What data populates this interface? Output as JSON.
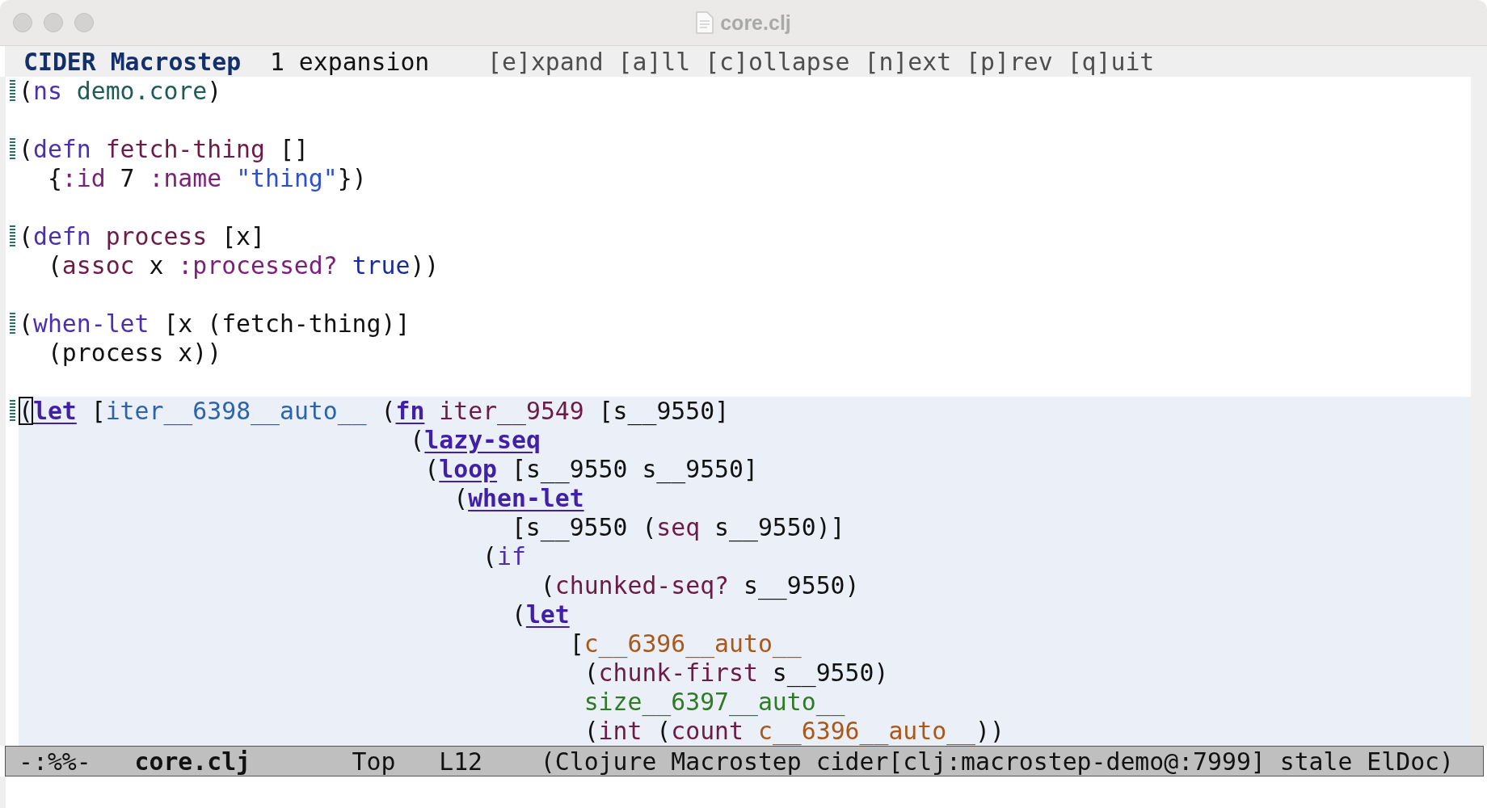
{
  "window": {
    "title": "core.clj"
  },
  "header_line": {
    "mode": "CIDER Macrostep",
    "count": "1 expansion",
    "keys": "[e]xpand [a]ll [c]ollapse [n]ext [p]rev [q]uit"
  },
  "lines": [
    {
      "kind": "code",
      "fringe": true,
      "expanded": false,
      "tokens": [
        {
          "kind": "plain",
          "text": "("
        },
        {
          "kind": "special",
          "text": "ns"
        },
        {
          "kind": "namespace",
          "text": " demo.core"
        },
        {
          "kind": "plain",
          "text": ")"
        }
      ]
    },
    {
      "kind": "blank"
    },
    {
      "kind": "code",
      "fringe": true,
      "expanded": false,
      "tokens": [
        {
          "kind": "plain",
          "text": "("
        },
        {
          "kind": "special",
          "text": "defn"
        },
        {
          "kind": "function",
          "text": " fetch-thing"
        },
        {
          "kind": "plain",
          "text": " []"
        }
      ]
    },
    {
      "kind": "code",
      "fringe": false,
      "expanded": false,
      "tokens": [
        {
          "kind": "plain",
          "text": "  {"
        },
        {
          "kind": "keyword",
          "text": ":id"
        },
        {
          "kind": "plain",
          "text": " 7 "
        },
        {
          "kind": "keyword",
          "text": ":name"
        },
        {
          "kind": "string",
          "text": " \"thing\""
        },
        {
          "kind": "plain",
          "text": "})"
        }
      ]
    },
    {
      "kind": "blank"
    },
    {
      "kind": "code",
      "fringe": true,
      "expanded": false,
      "tokens": [
        {
          "kind": "plain",
          "text": "("
        },
        {
          "kind": "special",
          "text": "defn"
        },
        {
          "kind": "function",
          "text": " process"
        },
        {
          "kind": "plain",
          "text": " [x]"
        }
      ]
    },
    {
      "kind": "code",
      "fringe": false,
      "expanded": false,
      "tokens": [
        {
          "kind": "plain",
          "text": "  ("
        },
        {
          "kind": "function",
          "text": "assoc"
        },
        {
          "kind": "plain",
          "text": " x "
        },
        {
          "kind": "keyword",
          "text": ":processed?"
        },
        {
          "kind": "constant",
          "text": " true"
        },
        {
          "kind": "plain",
          "text": "))"
        }
      ]
    },
    {
      "kind": "blank"
    },
    {
      "kind": "code",
      "fringe": true,
      "expanded": false,
      "tokens": [
        {
          "kind": "plain",
          "text": "("
        },
        {
          "kind": "special",
          "text": "when-let"
        },
        {
          "kind": "plain",
          "text": " [x (fetch-thing)]"
        }
      ]
    },
    {
      "kind": "code",
      "fringe": false,
      "expanded": false,
      "tokens": [
        {
          "kind": "plain",
          "text": "  (process x))"
        }
      ]
    },
    {
      "kind": "blank"
    },
    {
      "kind": "code",
      "fringe": true,
      "expanded": true,
      "tokens": [
        {
          "kind": "cursor",
          "text": "("
        },
        {
          "kind": "macro",
          "text": "let"
        },
        {
          "kind": "plain",
          "text": " ["
        },
        {
          "kind": "binding",
          "text": "iter__6398__auto__"
        },
        {
          "kind": "plain",
          "text": " ("
        },
        {
          "kind": "macro",
          "text": "fn"
        },
        {
          "kind": "function",
          "text": " iter__9549"
        },
        {
          "kind": "plain",
          "text": " [s__9550]"
        }
      ]
    },
    {
      "kind": "code",
      "fringe": false,
      "expanded": true,
      "tokens": [
        {
          "kind": "plain",
          "text": "                           ("
        },
        {
          "kind": "macro",
          "text": "lazy-seq"
        }
      ]
    },
    {
      "kind": "code",
      "fringe": false,
      "expanded": true,
      "tokens": [
        {
          "kind": "plain",
          "text": "                            ("
        },
        {
          "kind": "macro",
          "text": "loop"
        },
        {
          "kind": "plain",
          "text": " [s__9550 s__9550]"
        }
      ]
    },
    {
      "kind": "code",
      "fringe": false,
      "expanded": true,
      "tokens": [
        {
          "kind": "plain",
          "text": "                              ("
        },
        {
          "kind": "macro",
          "text": "when-let"
        }
      ]
    },
    {
      "kind": "code",
      "fringe": false,
      "expanded": true,
      "tokens": [
        {
          "kind": "plain",
          "text": "                                  [s__9550 ("
        },
        {
          "kind": "function",
          "text": "seq"
        },
        {
          "kind": "plain",
          "text": " s__9550)]"
        }
      ]
    },
    {
      "kind": "code",
      "fringe": false,
      "expanded": true,
      "tokens": [
        {
          "kind": "plain",
          "text": "                                ("
        },
        {
          "kind": "special",
          "text": "if"
        }
      ]
    },
    {
      "kind": "code",
      "fringe": false,
      "expanded": true,
      "tokens": [
        {
          "kind": "plain",
          "text": "                                    ("
        },
        {
          "kind": "function",
          "text": "chunked-seq?"
        },
        {
          "kind": "plain",
          "text": " s__9550)"
        }
      ]
    },
    {
      "kind": "code",
      "fringe": false,
      "expanded": true,
      "tokens": [
        {
          "kind": "plain",
          "text": "                                  ("
        },
        {
          "kind": "macro",
          "text": "let"
        }
      ]
    },
    {
      "kind": "code",
      "fringe": false,
      "expanded": true,
      "tokens": [
        {
          "kind": "plain",
          "text": "                                      ["
        },
        {
          "kind": "gensym-a",
          "text": "c__6396__auto__"
        }
      ]
    },
    {
      "kind": "code",
      "fringe": false,
      "expanded": true,
      "tokens": [
        {
          "kind": "plain",
          "text": "                                       ("
        },
        {
          "kind": "function",
          "text": "chunk-first"
        },
        {
          "kind": "plain",
          "text": " s__9550)"
        }
      ]
    },
    {
      "kind": "code",
      "fringe": false,
      "expanded": true,
      "tokens": [
        {
          "kind": "gensym-b",
          "text": "                                       size__6397__auto__"
        }
      ]
    },
    {
      "kind": "code",
      "fringe": false,
      "expanded": true,
      "tokens": [
        {
          "kind": "plain",
          "text": "                                       ("
        },
        {
          "kind": "function",
          "text": "int"
        },
        {
          "kind": "plain",
          "text": " ("
        },
        {
          "kind": "function",
          "text": "count"
        },
        {
          "kind": "gensym-a",
          "text": " c__6396__auto__"
        },
        {
          "kind": "plain",
          "text": "))"
        }
      ]
    }
  ],
  "mode_line": {
    "state": "-:%%-",
    "buffer": "core.clj",
    "position": "Top",
    "line": "L12",
    "modes": "(Clojure Macrostep cider[clj:macrostep-demo@:7999] stale ElDoc)"
  }
}
